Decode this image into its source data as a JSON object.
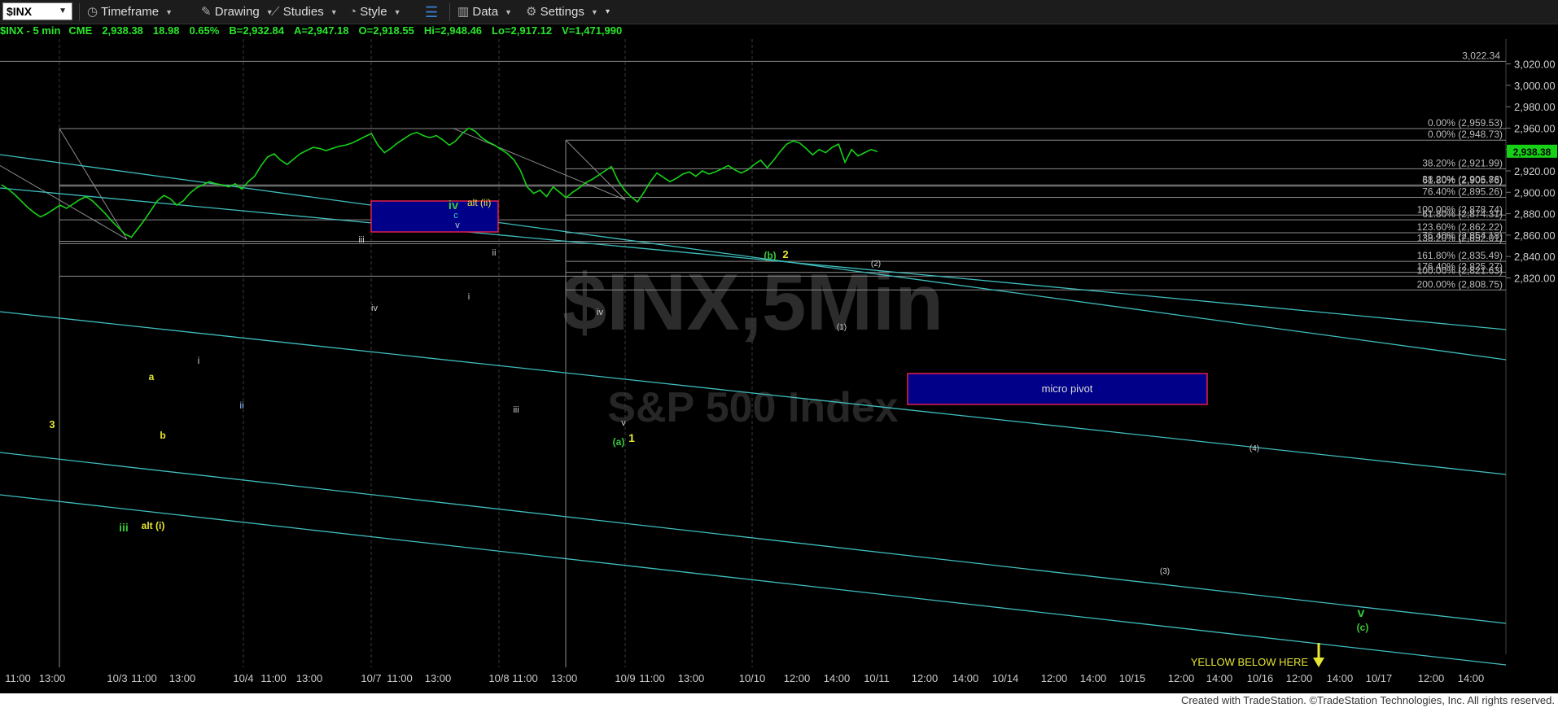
{
  "toolbar": {
    "symbol": "$INX",
    "timeframe": "Timeframe",
    "drawing": "Drawing",
    "studies": "Studies",
    "style": "Style",
    "data": "Data",
    "settings": "Settings"
  },
  "quote": {
    "title": "$INX - 5 min",
    "exchange": "CME",
    "last": "2,938.38",
    "change": "18.98",
    "pct": "0.65%",
    "bid": "B=2,932.84",
    "ask": "A=2,947.18",
    "open": "O=2,918.55",
    "high": "Hi=2,948.46",
    "low": "Lo=2,917.12",
    "volume": "V=1,471,990"
  },
  "watermark": {
    "main": "$INX,5Min",
    "sub": "S&P 500 Index"
  },
  "footer": "Created with TradeStation. ©TradeStation Technologies, Inc. All rights reserved.",
  "colors": {
    "price": "#17d117",
    "channel": "#3fbdbd",
    "box": "#000088",
    "box_border": "#e0204a",
    "green_label": "#38c838",
    "yellow_label": "#e6e632"
  },
  "chart_data": {
    "type": "line",
    "title": "",
    "ylim": [
      2800,
      3030
    ],
    "y_ticks": [
      "3,020.00",
      "3,000.00",
      "2,980.00",
      "2,960.00",
      "2,940.00",
      "2,920.00",
      "2,900.00",
      "2,880.00",
      "2,860.00",
      "2,840.00",
      "2,820.00"
    ],
    "x_ticks": [
      "11:00",
      "13:00",
      "10/3",
      "11:00",
      "13:00",
      "10/4",
      "11:00",
      "13:00",
      "10/7",
      "11:00",
      "13:00",
      "10/8",
      "11:00",
      "13:00",
      "10/9",
      "11:00",
      "13:00",
      "10/10",
      "12:00",
      "14:00",
      "10/11",
      "12:00",
      "14:00",
      "10/14",
      "12:00",
      "14:00",
      "10/15",
      "12:00",
      "14:00",
      "10/16",
      "12:00",
      "14:00",
      "10/17",
      "12:00",
      "14:00"
    ],
    "last_price": 2938.38,
    "last_price_label": "2,938.38",
    "high_level": {
      "label": "3,022.34",
      "value": 3022.34
    },
    "series": [
      {
        "values": [
          2907,
          2903,
          2898,
          2892,
          2886,
          2881,
          2877,
          2880,
          2884,
          2888,
          2885,
          2889,
          2893,
          2896,
          2892,
          2886,
          2880,
          2873,
          2867,
          2861,
          2858,
          2866,
          2874,
          2883,
          2892,
          2897,
          2894,
          2888,
          2892,
          2899,
          2904,
          2907,
          2910,
          2908,
          2907,
          2905,
          2908,
          2903,
          2910,
          2915,
          2925,
          2933,
          2936,
          2930,
          2926,
          2931,
          2936,
          2939,
          2942,
          2941,
          2939,
          2941,
          2943,
          2944,
          2946,
          2949,
          2952,
          2955,
          2944,
          2937,
          2941,
          2946,
          2950,
          2954,
          2956,
          2953,
          2951,
          2953,
          2949,
          2944,
          2948,
          2955,
          2960,
          2957,
          2951,
          2947,
          2944,
          2940,
          2936,
          2930,
          2920,
          2905,
          2899,
          2902,
          2896,
          2905,
          2900,
          2895,
          2900,
          2904,
          2909,
          2912,
          2916,
          2920,
          2924,
          2911,
          2902,
          2896,
          2891,
          2900,
          2910,
          2918,
          2914,
          2910,
          2913,
          2917,
          2919,
          2915,
          2920,
          2917,
          2919,
          2922,
          2925,
          2921,
          2918,
          2921,
          2926,
          2930,
          2923,
          2930,
          2938,
          2945,
          2948,
          2946,
          2941,
          2935,
          2940,
          2937,
          2942,
          2945,
          2928,
          2940,
          2934,
          2937,
          2940,
          2938
        ]
      }
    ],
    "fib_levels": [
      {
        "label": "0.00% (2,959.53)",
        "value": 2959.53
      },
      {
        "label": "0.00% (2,948.73)",
        "value": 2948.73
      },
      {
        "label": "38.20% (2,921.99)",
        "value": 2921.99
      },
      {
        "label": "38.20% (2,906.86)",
        "value": 2906.86
      },
      {
        "label": "61.80% (2,905.76)",
        "value": 2905.76
      },
      {
        "label": "76.40% (2,895.26)",
        "value": 2895.26
      },
      {
        "label": "100.00% (2,878.74)",
        "value": 2878.74
      },
      {
        "label": "61.80% (2,874.31)",
        "value": 2874.31
      },
      {
        "label": "123.60% (2,862.22)",
        "value": 2862.22
      },
      {
        "label": "76.40% (2,854.18)",
        "value": 2854.18
      },
      {
        "label": "138.20% (2,852.01)",
        "value": 2852.01
      },
      {
        "label": "161.80% (2,835.49)",
        "value": 2835.49
      },
      {
        "label": "176.40% (2,825.27)",
        "value": 2825.27
      },
      {
        "label": "100.00% (2,821.63)",
        "value": 2821.63
      },
      {
        "label": "200.00% (2,808.75)",
        "value": 2808.75
      }
    ],
    "box_labels": {
      "alt_ii": "alt (ii)",
      "micro_pivot": "micro pivot"
    },
    "wave_labels": [
      {
        "text": "3",
        "color": "yellow"
      },
      {
        "text": "a",
        "color": "yellow"
      },
      {
        "text": "b",
        "color": "yellow"
      },
      {
        "text": "iii",
        "color": "green"
      },
      {
        "text": "alt (i)",
        "color": "yellow"
      },
      {
        "text": "i",
        "color": "white"
      },
      {
        "text": "ii",
        "color": "blue"
      },
      {
        "text": "iii",
        "color": "white"
      },
      {
        "text": "iv",
        "color": "white"
      },
      {
        "text": "iv",
        "color": "green"
      },
      {
        "text": "c",
        "color": "cyan"
      },
      {
        "text": "v",
        "color": "white"
      },
      {
        "text": "i",
        "color": "white"
      },
      {
        "text": "ii",
        "color": "white"
      },
      {
        "text": "iii",
        "color": "white"
      },
      {
        "text": "iv",
        "color": "white"
      },
      {
        "text": "v",
        "color": "white"
      },
      {
        "text": "(a)",
        "color": "green"
      },
      {
        "text": "1",
        "color": "yellow"
      },
      {
        "text": "(b)",
        "color": "green"
      },
      {
        "text": "2",
        "color": "yellow"
      },
      {
        "text": "(1)",
        "color": "white"
      },
      {
        "text": "(2)",
        "color": "white"
      },
      {
        "text": "(3)",
        "color": "white"
      },
      {
        "text": "(4)",
        "color": "white"
      },
      {
        "text": "v",
        "color": "green"
      },
      {
        "text": "(c)",
        "color": "green"
      }
    ],
    "annotation": "YELLOW BELOW HERE"
  }
}
